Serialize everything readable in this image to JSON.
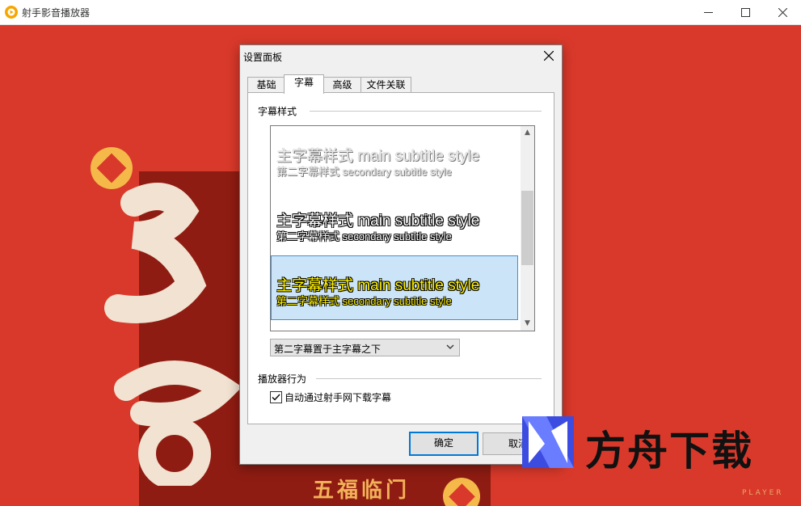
{
  "window": {
    "title": "射手影音播放器",
    "minimize_icon": "minimize-icon",
    "maximize_icon": "maximize-icon",
    "close_icon": "close-icon"
  },
  "background": {
    "primary_color": "#d9392a",
    "banner_color": "#8f1c12",
    "accent_color": "#f5b94a",
    "blessing_text": "五福临门"
  },
  "dialog": {
    "title": "设置面板",
    "tabs": [
      {
        "label": "基础",
        "active": false
      },
      {
        "label": "字幕",
        "active": true
      },
      {
        "label": "高级",
        "active": false
      },
      {
        "label": "文件关联",
        "active": false
      }
    ],
    "subtitle_group_label": "字幕样式",
    "style_options": [
      {
        "main": "主字幕样式 main subtitle style",
        "secondary": "第二字幕样式 secondary subtitle style",
        "style": "light",
        "selected": false
      },
      {
        "main": "主字幕样式 main subtitle style",
        "secondary": "第二字幕样式 secondary subtitle style",
        "style": "white",
        "selected": false
      },
      {
        "main": "主字幕样式 main subtitle style",
        "secondary": "第二字幕样式 secondary subtitle style",
        "style": "yellow",
        "selected": true
      }
    ],
    "position_select": {
      "value": "第二字幕置于主字幕之下"
    },
    "player_group_label": "播放器行为",
    "auto_download": {
      "label": "自动通过射手网下载字幕",
      "checked": true
    },
    "ok_label": "确定",
    "cancel_label": "取消"
  },
  "watermark": {
    "text": "方舟下载",
    "player_mark": "PLAYER"
  }
}
